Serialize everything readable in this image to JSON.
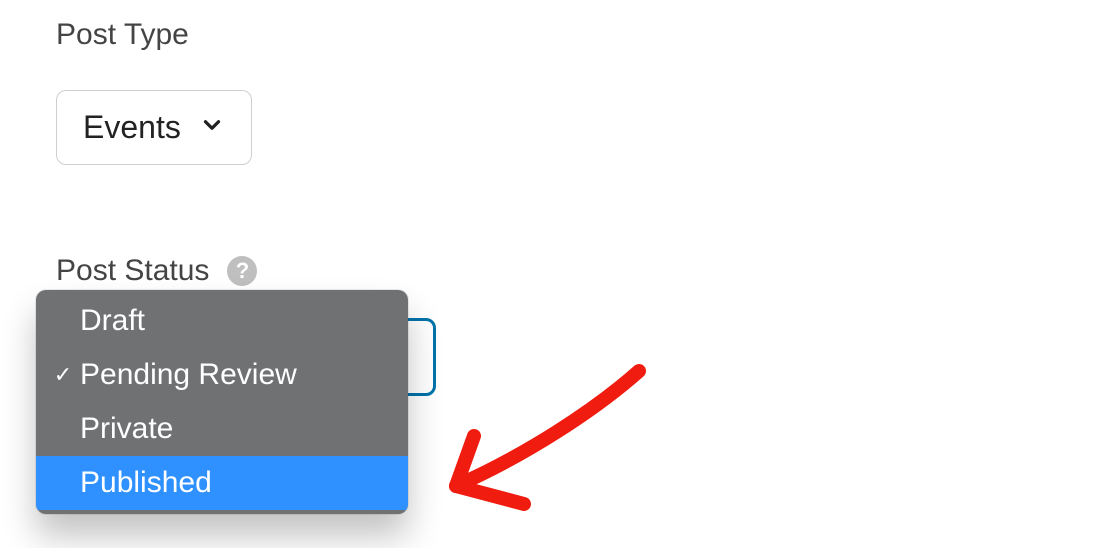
{
  "postType": {
    "label": "Post Type",
    "selected": "Events"
  },
  "postStatus": {
    "label": "Post Status",
    "helpGlyph": "?",
    "options": [
      {
        "label": "Draft",
        "checked": false,
        "highlight": false
      },
      {
        "label": "Pending Review",
        "checked": true,
        "highlight": false
      },
      {
        "label": "Private",
        "checked": false,
        "highlight": false
      },
      {
        "label": "Published",
        "checked": false,
        "highlight": true
      }
    ]
  }
}
